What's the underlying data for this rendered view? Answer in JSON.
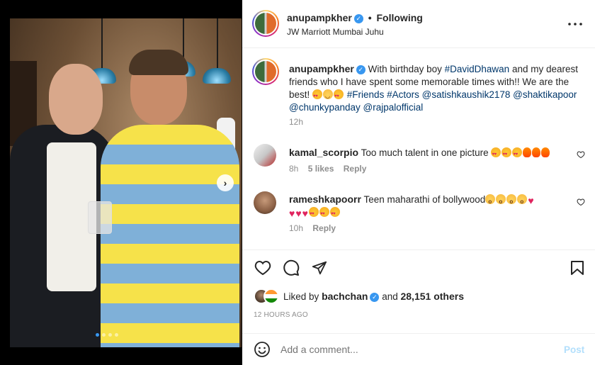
{
  "post": {
    "username": "anupampkher",
    "follow_status": "Following",
    "location": "JW Marriott Mumbai Juhu",
    "carousel_total": 4,
    "carousel_index": 1
  },
  "caption": {
    "username": "anupampkher",
    "text_1": "With birthday boy ",
    "tag_1": "#DavidDhawan",
    "text_2": " and my dearest friends who I have spent some memorable times with!! We are the best! ",
    "tags_line": "#Friends #Actors",
    "mention_1": "@satishkaushik2178",
    "mention_2": "@shaktikapoor",
    "mention_3": "@chunkypanday",
    "mention_4": "@rajpalofficial",
    "time": "12h"
  },
  "comments": [
    {
      "username": "kamal_scorpio",
      "text": "Too much talent in one picture",
      "time": "8h",
      "likes": "5 likes",
      "reply": "Reply"
    },
    {
      "username": "rameshkapoorr",
      "text": "Teen maharathi of bollywood",
      "time": "10h",
      "reply": "Reply"
    }
  ],
  "likes": {
    "prefix": "Liked by",
    "user": "bachchan",
    "and": "and",
    "count": "28,151 others"
  },
  "timestamp": "12 HOURS AGO",
  "comment_input": {
    "placeholder": "Add a comment...",
    "post_label": "Post"
  },
  "colors": {
    "accent": "#3897f0",
    "link": "#00376b",
    "muted": "#8e8e8e"
  },
  "icons": [
    "more-icon",
    "like-icon",
    "comment-icon",
    "share-icon",
    "save-icon",
    "emoji-icon",
    "next-icon",
    "verified-icon"
  ]
}
